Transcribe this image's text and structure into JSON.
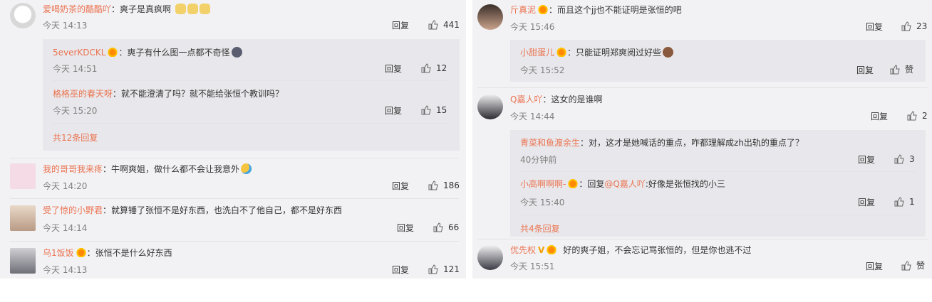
{
  "left": {
    "comments": [
      {
        "user": "爱喝奶茶的酷酷吖",
        "text": "：爽子是真疯啊",
        "time": "今天 14:13",
        "reply": "回复",
        "likes": "441",
        "emoji": [
          "cat-emoji",
          "cat-emoji",
          "cat-emoji"
        ],
        "replies": [
          {
            "user": "5everKDCKL",
            "text": "：爽子有什么图一点都不奇怪",
            "time": "今天 14:51",
            "reply": "回复",
            "likes": "12",
            "badge": true,
            "emoji": [
              "dark-emoji"
            ]
          },
          {
            "user": "格格巫的春天呀",
            "text": "：就不能澄清了吗？就不能给张恒个教训吗？",
            "time": "今天 15:20",
            "reply": "回复",
            "likes": "15"
          }
        ],
        "more": "共12条回复"
      },
      {
        "user": "我的哥哥我来疼",
        "text": "：牛啊爽姐，做什么都不会让我意外",
        "time": "今天 14:20",
        "reply": "回复",
        "likes": "186",
        "emoji": [
          "cry-emoji"
        ]
      },
      {
        "user": "受了惊的小野君",
        "text": "：就算锤了张恒不是好东西，也洗白不了他自己，都不是好东西",
        "time": "今天 14:14",
        "reply": "回复",
        "likes": "66"
      },
      {
        "user": "乌1饭饭",
        "text": "：张恒不是什么好东西",
        "time": "今天 14:13",
        "reply": "回复",
        "likes": "121",
        "badge": true
      }
    ]
  },
  "right": {
    "comments": [
      {
        "user": "斤真泥",
        "text": "：而且这个jj也不能证明是张恒的吧",
        "time": "今天 15:46",
        "reply": "回复",
        "likes": "23",
        "badge": true,
        "replies": [
          {
            "user": "小甜蛋儿",
            "text": "：只能证明郑爽阅过好些",
            "time": "今天 15:52",
            "reply": "回复",
            "likes": "赞",
            "badge": true,
            "emoji": [
              "horse-emoji"
            ]
          }
        ]
      },
      {
        "user": "Q嘉人吖",
        "text": "：这女的是谁啊",
        "time": "今天 14:44",
        "reply": "回复",
        "likes": "2",
        "replies": [
          {
            "user": "青菜和鱼渡余生",
            "text": "：对，这才是她喊话的重点，咋都理解成zh出轨的重点了？",
            "time": "40分钟前",
            "reply": "回复",
            "likes": "3"
          },
          {
            "user": "小高啊啊啊-",
            "text": "：回复",
            "mention": "@Q嘉人吖",
            "text2": ":好像是张恒找的小三",
            "time": "今天 15:40",
            "reply": "回复",
            "likes": "1",
            "badge": true
          }
        ],
        "more": "共4条回复"
      },
      {
        "user": "优先权",
        "vip": "V",
        "text": "好的爽子姐，不会忘记骂张恒的，但是你也逃不过",
        "time": "今天 15:51",
        "reply": "回复",
        "likes": "赞",
        "badge": true
      }
    ]
  },
  "colors": {
    "username": "#eb7350",
    "meta": "#808080",
    "panel": "#f2f2f5",
    "subpanel": "#e8e8ec"
  }
}
